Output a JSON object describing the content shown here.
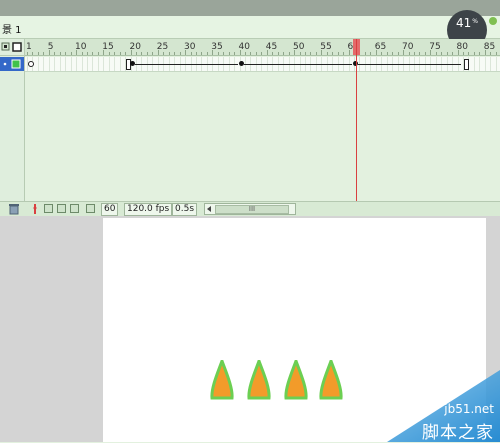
{
  "scene": {
    "label": "景 1"
  },
  "zoom_badge": {
    "value": "41",
    "unit": "%"
  },
  "ruler": {
    "marks": [
      "1",
      "5",
      "10",
      "15",
      "20",
      "25",
      "30",
      "35",
      "40",
      "45",
      "50",
      "55",
      "60",
      "65",
      "70",
      "75",
      "80",
      "85"
    ]
  },
  "layers": [
    {
      "name": "",
      "selected": true,
      "icon": "layer-color-box-icon"
    }
  ],
  "status": {
    "current_frame": "60",
    "frame_rate": "120.0 fps",
    "elapsed": "0.5s",
    "scroll_thumb": "III"
  },
  "stage": {
    "cone_fill": "#f29b2a",
    "cone_stroke": "#6ccf52",
    "cone_count": 4
  },
  "watermark": {
    "site": "jb51.net",
    "brand": "脚本之家"
  },
  "icons": [
    "trash-icon",
    "pencil-icon",
    "onion-skin-icon",
    "onion-skin-outline-icon",
    "edit-multiple-frames-icon",
    "modify-markers-icon"
  ]
}
